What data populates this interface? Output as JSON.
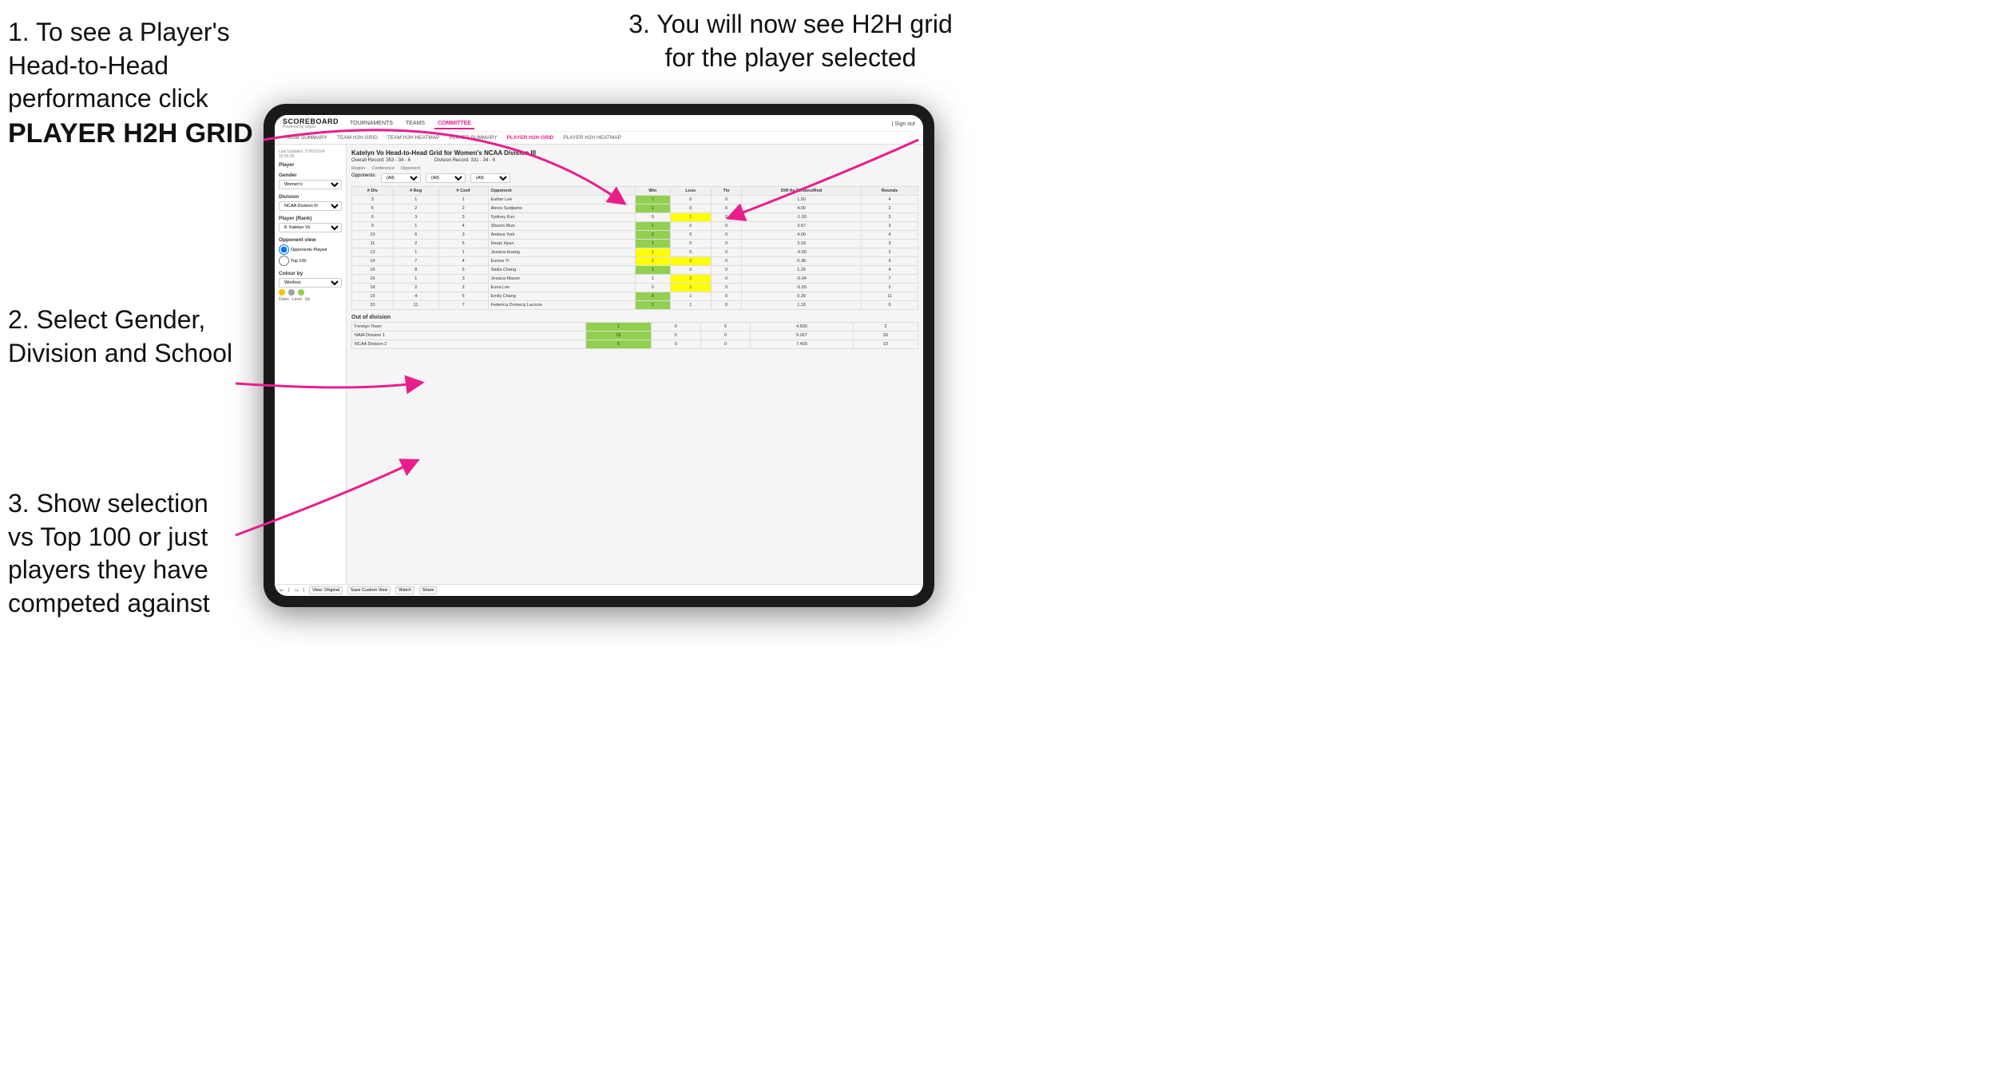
{
  "instructions": {
    "top_left_1": "1. To see a Player's Head-to-Head performance click",
    "top_left_2": "PLAYER H2H GRID",
    "top_right": "3. You will now see H2H grid for the player selected",
    "mid_left": "2. Select Gender, Division and School",
    "bottom_left": "3. Show selection vs Top 100 or just players they have competed against"
  },
  "nav": {
    "logo": "SCOREBOARD",
    "logo_sub": "Powered by clippd",
    "links": [
      "TOURNAMENTS",
      "TEAMS",
      "COMMITTEE"
    ],
    "active_link": "COMMITTEE",
    "sign_in": "| Sign out",
    "sub_links": [
      "TEAM SUMMARY",
      "TEAM H2H GRID",
      "TEAM H2H HEATMAP",
      "PLAYER SUMMARY",
      "PLAYER H2H GRID",
      "PLAYER H2H HEATMAP"
    ],
    "active_sub": "PLAYER H2H GRID"
  },
  "left_panel": {
    "last_updated": "Last Updated: 27/03/2024",
    "time": "16:55:38",
    "player_label": "Player",
    "gender_label": "Gender",
    "gender_value": "Women's",
    "division_label": "Division",
    "division_value": "NCAA Division III",
    "player_rank_label": "Player (Rank)",
    "player_rank_value": "8. Katelyn Vo",
    "opponent_view_label": "Opponent view",
    "radio1": "Opponents Played",
    "radio2": "Top 100",
    "colour_by_label": "Colour by",
    "colour_by_value": "Win/loss",
    "legend": [
      "Down",
      "Level",
      "Up"
    ]
  },
  "h2h": {
    "title": "Katelyn Vo Head-to-Head Grid for Women's NCAA Division III",
    "overall_record": "Overall Record: 353 - 34 - 6",
    "division_record": "Division Record: 331 - 34 - 6",
    "region_label": "Region",
    "conference_label": "Conference",
    "opponent_label": "Opponent",
    "opponents_label": "Opponents:",
    "opponents_value": "(All)",
    "conference_value": "(All)",
    "opponent_value": "(All)",
    "columns": [
      "# Div",
      "# Reg",
      "# Conf",
      "Opponent",
      "Win",
      "Loss",
      "Tie",
      "Diff Av Strokes/Rnd",
      "Rounds"
    ],
    "rows": [
      {
        "div": 3,
        "reg": 1,
        "conf": 1,
        "opponent": "Esther Lee",
        "win": 1,
        "loss": 0,
        "tie": 0,
        "diff": "1.50",
        "rounds": 4,
        "win_color": "green",
        "loss_color": "",
        "tie_color": ""
      },
      {
        "div": 5,
        "reg": 2,
        "conf": 2,
        "opponent": "Alexis Sudjianto",
        "win": 1,
        "loss": 0,
        "tie": 0,
        "diff": "4.00",
        "rounds": 3,
        "win_color": "green"
      },
      {
        "div": 6,
        "reg": 3,
        "conf": 3,
        "opponent": "Sydney Kuo",
        "win": 0,
        "loss": 1,
        "tie": 0,
        "diff": "-1.00",
        "rounds": 3,
        "loss_color": "yellow"
      },
      {
        "div": 9,
        "reg": 1,
        "conf": 4,
        "opponent": "Sharon Mun",
        "win": 1,
        "loss": 0,
        "tie": 0,
        "diff": "3.67",
        "rounds": 3,
        "win_color": "green"
      },
      {
        "div": 10,
        "reg": 6,
        "conf": 3,
        "opponent": "Andrea York",
        "win": 2,
        "loss": 0,
        "tie": 0,
        "diff": "4.00",
        "rounds": 4,
        "win_color": "green"
      },
      {
        "div": 11,
        "reg": 2,
        "conf": 5,
        "opponent": "Heejo Hyun",
        "win": 1,
        "loss": 0,
        "tie": 0,
        "diff": "3.33",
        "rounds": 3,
        "win_color": "green"
      },
      {
        "div": 13,
        "reg": 1,
        "conf": 1,
        "opponent": "Jessica Huang",
        "win": 1,
        "loss": 0,
        "tie": 0,
        "diff": "-3.00",
        "rounds": 2,
        "win_color": "yellow"
      },
      {
        "div": 14,
        "reg": 7,
        "conf": 4,
        "opponent": "Eunice Yi",
        "win": 2,
        "loss": 2,
        "tie": 0,
        "diff": "0.38",
        "rounds": 9,
        "win_color": "yellow",
        "loss_color": "yellow"
      },
      {
        "div": 15,
        "reg": 8,
        "conf": 5,
        "opponent": "Stella Cheng",
        "win": 1,
        "loss": 0,
        "tie": 0,
        "diff": "1.25",
        "rounds": 4,
        "win_color": "green"
      },
      {
        "div": 16,
        "reg": 1,
        "conf": 3,
        "opponent": "Jessica Mason",
        "win": 1,
        "loss": 2,
        "tie": 0,
        "diff": "-0.94",
        "rounds": 7,
        "loss_color": "yellow"
      },
      {
        "div": 18,
        "reg": 2,
        "conf": 2,
        "opponent": "Euna Lee",
        "win": 0,
        "loss": 1,
        "tie": 0,
        "diff": "-5.00",
        "rounds": 2,
        "loss_color": "yellow"
      },
      {
        "div": 19,
        "reg": 4,
        "conf": 6,
        "opponent": "Emily Chang",
        "win": 4,
        "loss": 1,
        "tie": 0,
        "diff": "0.30",
        "rounds": 11,
        "win_color": "green"
      },
      {
        "div": 20,
        "reg": 11,
        "conf": 7,
        "opponent": "Federica Domecq Lacroze",
        "win": 2,
        "loss": 1,
        "tie": 0,
        "diff": "1.33",
        "rounds": 6,
        "win_color": "green"
      }
    ],
    "out_of_division_label": "Out of division",
    "out_rows": [
      {
        "opponent": "Foreign Team",
        "win": 1,
        "loss": 0,
        "tie": 0,
        "diff": "4.500",
        "rounds": 2
      },
      {
        "opponent": "NAIA Division 1",
        "win": 15,
        "loss": 0,
        "tie": 0,
        "diff": "9.267",
        "rounds": 30
      },
      {
        "opponent": "NCAA Division 2",
        "win": 5,
        "loss": 0,
        "tie": 0,
        "diff": "7.400",
        "rounds": 10
      }
    ]
  },
  "toolbar": {
    "view_original": "View: Original",
    "save_custom": "Save Custom View",
    "watch": "Watch",
    "share": "Share"
  }
}
